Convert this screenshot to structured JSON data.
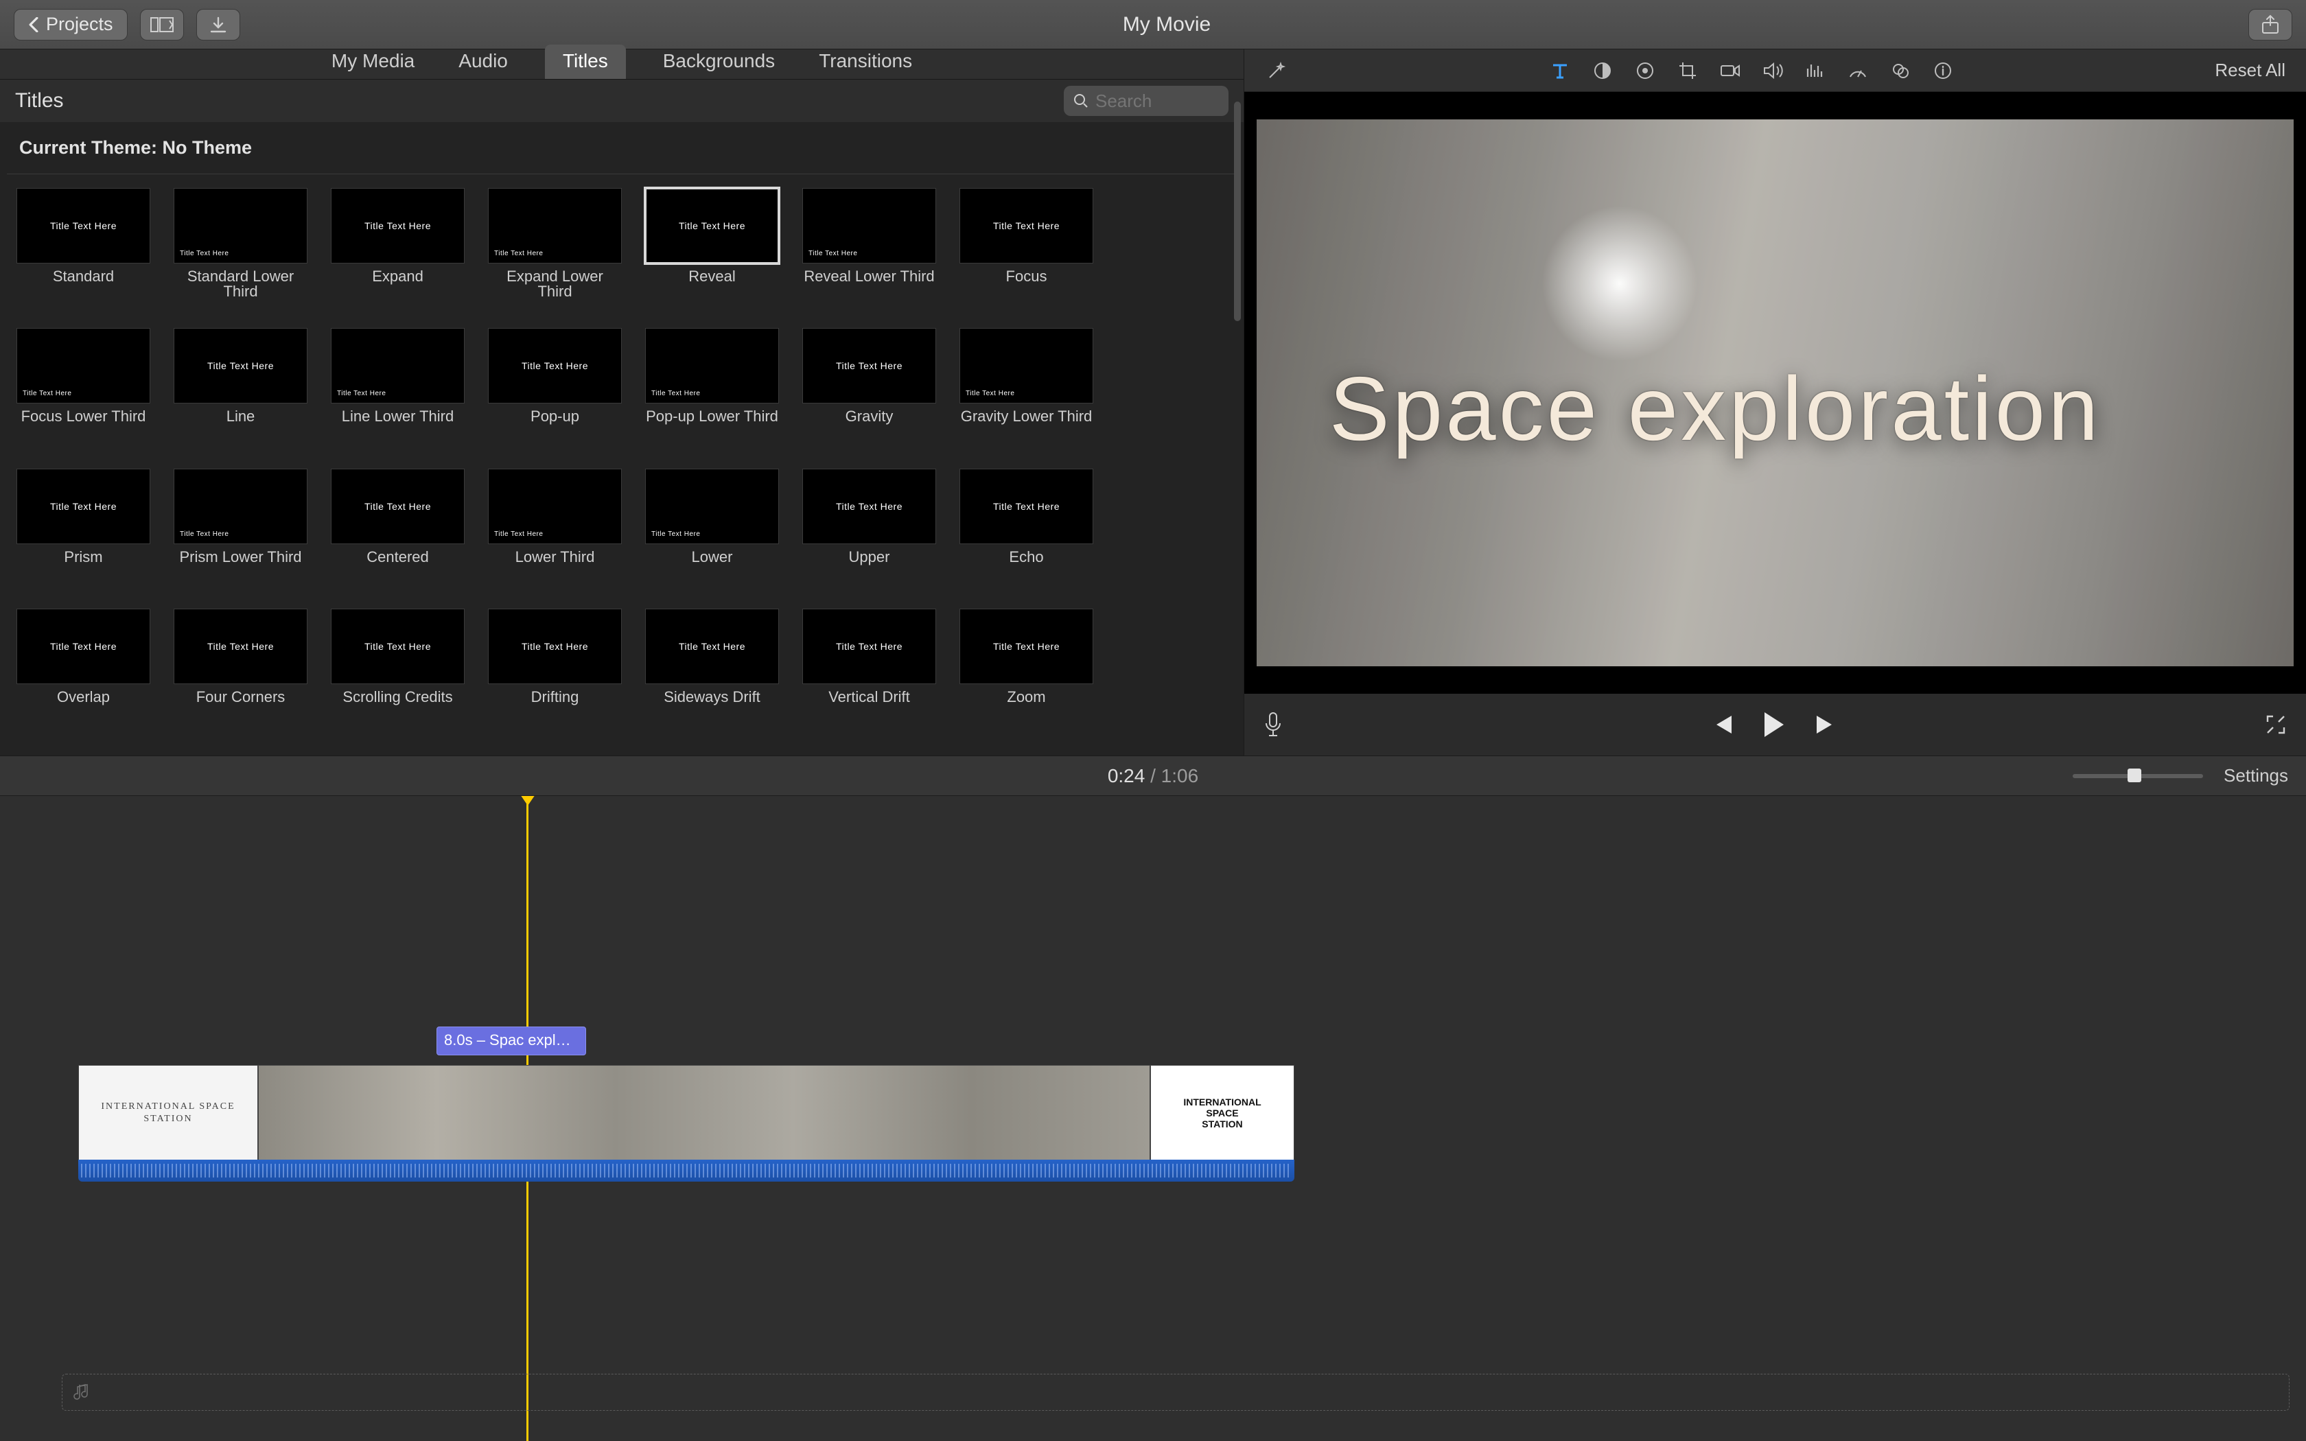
{
  "titlebar": {
    "back_label": "Projects",
    "movie_title": "My Movie"
  },
  "browser_tabs": {
    "my_media": "My Media",
    "audio": "Audio",
    "titles": "Titles",
    "backgrounds": "Backgrounds",
    "transitions": "Transitions",
    "active": "titles"
  },
  "browser_header": {
    "label": "Titles",
    "search_placeholder": "Search"
  },
  "theme": {
    "label": "Current Theme: No Theme"
  },
  "titles_grid": [
    {
      "name": "Standard"
    },
    {
      "name": "Standard Lower Third"
    },
    {
      "name": "Expand"
    },
    {
      "name": "Expand Lower Third"
    },
    {
      "name": "Reveal",
      "selected": true
    },
    {
      "name": "Reveal Lower Third"
    },
    {
      "name": "Focus"
    },
    {
      "name": "Focus Lower Third"
    },
    {
      "name": "Line"
    },
    {
      "name": "Line Lower Third"
    },
    {
      "name": "Pop-up"
    },
    {
      "name": "Pop-up Lower Third"
    },
    {
      "name": "Gravity"
    },
    {
      "name": "Gravity Lower Third"
    },
    {
      "name": "Prism"
    },
    {
      "name": "Prism Lower Third"
    },
    {
      "name": "Centered"
    },
    {
      "name": "Lower Third"
    },
    {
      "name": "Lower"
    },
    {
      "name": "Upper"
    },
    {
      "name": "Echo"
    },
    {
      "name": "Overlap"
    },
    {
      "name": "Four Corners"
    },
    {
      "name": "Scrolling Credits"
    },
    {
      "name": "Drifting"
    },
    {
      "name": "Sideways Drift"
    },
    {
      "name": "Vertical Drift"
    },
    {
      "name": "Zoom"
    }
  ],
  "adjust": {
    "reset": "Reset All"
  },
  "preview": {
    "title_text": "Space exploration"
  },
  "timecode": {
    "current": "0:24",
    "separator": " / ",
    "total": "1:06",
    "settings": "Settings"
  },
  "timeline": {
    "title_clip_label": "8.0s – Spac  expl…",
    "intro_text_line1": "INTERNATIONAL SPACE STATION",
    "outro_logo_line1": "INTERNATIONAL",
    "outro_logo_line2": "SPACE",
    "outro_logo_line3": "STATION"
  }
}
